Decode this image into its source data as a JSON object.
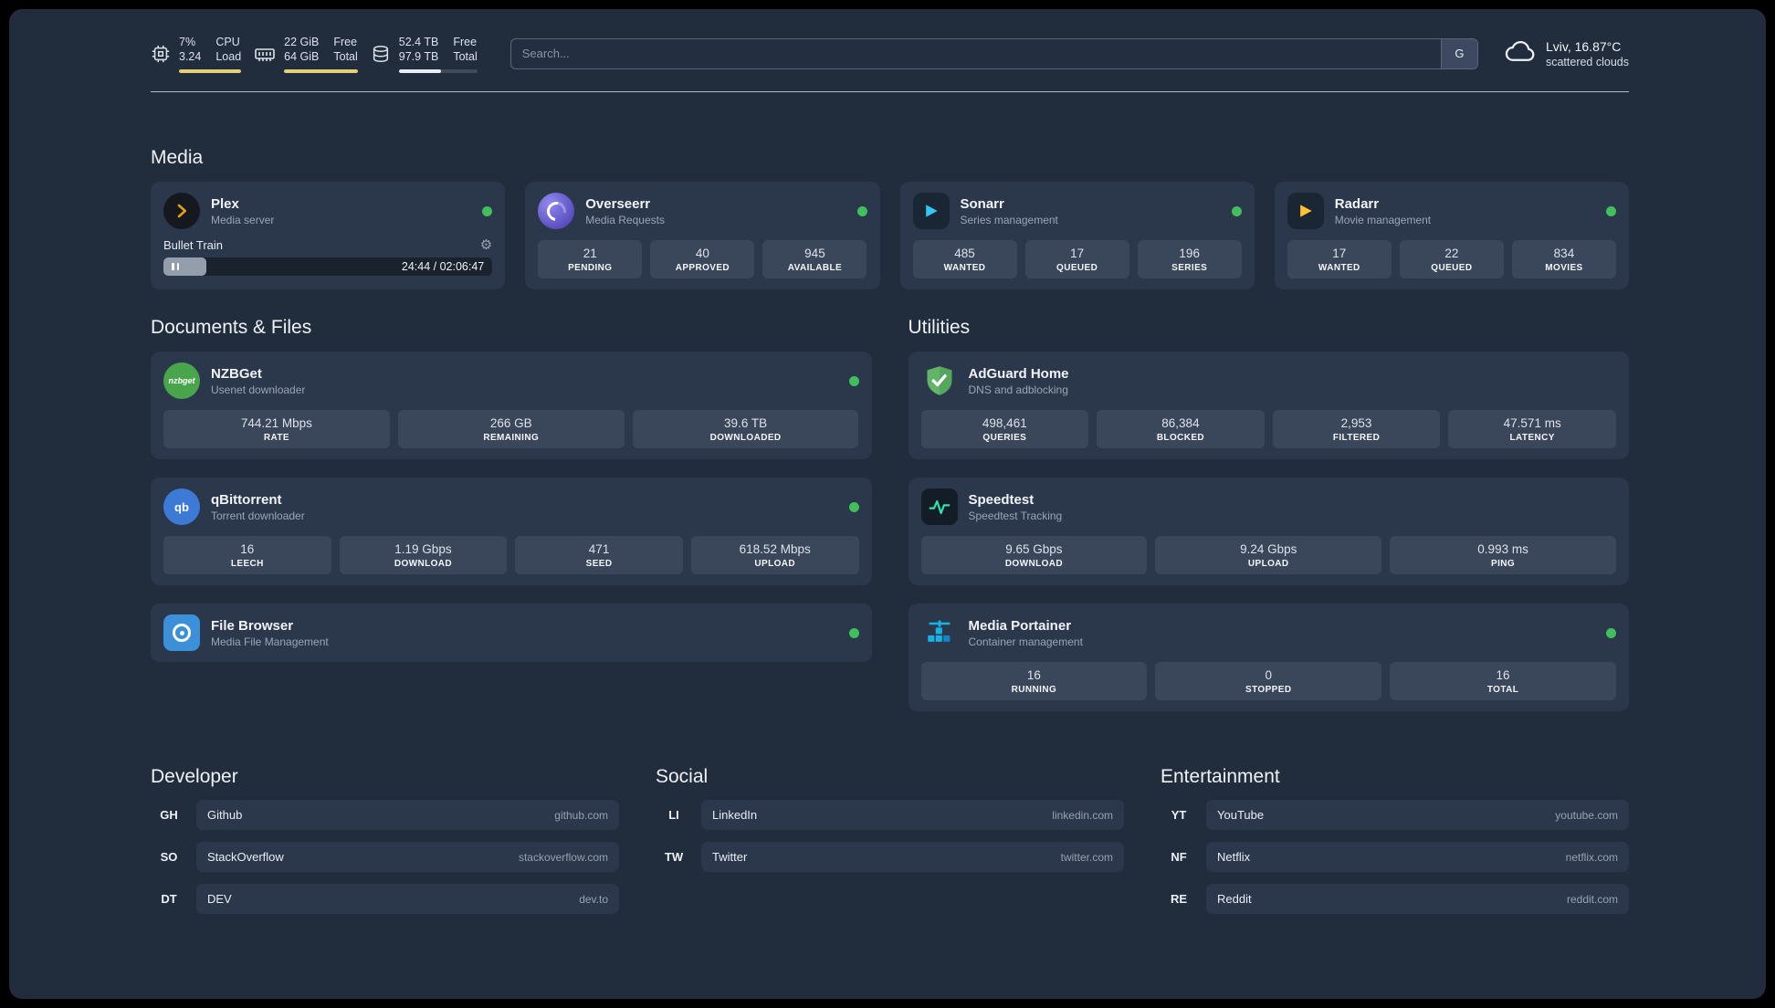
{
  "topbar": {
    "cpu": {
      "value_top": "7%",
      "value_bottom": "3.24",
      "label_top": "CPU",
      "label_bottom": "Load",
      "bar_percent": 100,
      "icon": "cpu-chip-icon"
    },
    "ram": {
      "value_top": "22 GiB",
      "value_bottom": "64 GiB",
      "label_top": "Free",
      "label_bottom": "Total",
      "bar_percent": 100,
      "icon": "memory-icon"
    },
    "disk": {
      "value_top": "52.4 TB",
      "value_bottom": "97.9 TB",
      "label_top": "Free",
      "label_bottom": "Total",
      "bar_percent": 54,
      "icon": "disk-icon"
    },
    "search": {
      "placeholder": "Search...",
      "engine_button": "G"
    },
    "weather": {
      "location": "Lviv, 16.87°C",
      "condition": "scattered clouds",
      "icon": "cloud-icon"
    }
  },
  "sections": {
    "media": {
      "title": "Media",
      "cards": [
        {
          "name": "Plex",
          "subtitle": "Media server",
          "status": "online",
          "icon": "plex-icon",
          "player": {
            "track": "Bullet Train",
            "time": "24:44 / 02:06:47",
            "progress_percent": 13
          }
        },
        {
          "name": "Overseerr",
          "subtitle": "Media Requests",
          "status": "online",
          "icon": "overseerr-icon",
          "stats": [
            {
              "value": "21",
              "label": "PENDING"
            },
            {
              "value": "40",
              "label": "APPROVED"
            },
            {
              "value": "945",
              "label": "AVAILABLE"
            }
          ]
        },
        {
          "name": "Sonarr",
          "subtitle": "Series management",
          "status": "online",
          "icon": "sonarr-icon",
          "stats": [
            {
              "value": "485",
              "label": "WANTED"
            },
            {
              "value": "17",
              "label": "QUEUED"
            },
            {
              "value": "196",
              "label": "SERIES"
            }
          ]
        },
        {
          "name": "Radarr",
          "subtitle": "Movie management",
          "status": "online",
          "icon": "radarr-icon",
          "stats": [
            {
              "value": "17",
              "label": "WANTED"
            },
            {
              "value": "22",
              "label": "QUEUED"
            },
            {
              "value": "834",
              "label": "MOVIES"
            }
          ]
        }
      ]
    },
    "documents": {
      "title": "Documents & Files",
      "cards": [
        {
          "name": "NZBGet",
          "subtitle": "Usenet downloader",
          "status": "online",
          "icon": "nzbget-icon",
          "stats": [
            {
              "value": "744.21 Mbps",
              "label": "RATE"
            },
            {
              "value": "266 GB",
              "label": "REMAINING"
            },
            {
              "value": "39.6 TB",
              "label": "DOWNLOADED"
            }
          ]
        },
        {
          "name": "qBittorrent",
          "subtitle": "Torrent downloader",
          "status": "online",
          "icon": "qbittorrent-icon",
          "stats": [
            {
              "value": "16",
              "label": "LEECH"
            },
            {
              "value": "1.19 Gbps",
              "label": "DOWNLOAD"
            },
            {
              "value": "471",
              "label": "SEED"
            },
            {
              "value": "618.52 Mbps",
              "label": "UPLOAD"
            }
          ]
        },
        {
          "name": "File Browser",
          "subtitle": "Media File Management",
          "status": "online",
          "icon": "filebrowser-icon"
        }
      ]
    },
    "utilities": {
      "title": "Utilities",
      "cards": [
        {
          "name": "AdGuard Home",
          "subtitle": "DNS and adblocking",
          "icon": "adguard-shield-icon",
          "stats": [
            {
              "value": "498,461",
              "label": "QUERIES"
            },
            {
              "value": "86,384",
              "label": "BLOCKED"
            },
            {
              "value": "2,953",
              "label": "FILTERED"
            },
            {
              "value": "47.571 ms",
              "label": "LATENCY"
            }
          ]
        },
        {
          "name": "Speedtest",
          "subtitle": "Speedtest Tracking",
          "icon": "speedtest-graph-icon",
          "stats": [
            {
              "value": "9.65 Gbps",
              "label": "DOWNLOAD"
            },
            {
              "value": "9.24 Gbps",
              "label": "UPLOAD"
            },
            {
              "value": "0.993 ms",
              "label": "PING"
            }
          ]
        },
        {
          "name": "Media Portainer",
          "subtitle": "Container management",
          "status": "online",
          "icon": "portainer-icon",
          "stats": [
            {
              "value": "16",
              "label": "RUNNING"
            },
            {
              "value": "0",
              "label": "STOPPED"
            },
            {
              "value": "16",
              "label": "TOTAL"
            }
          ]
        }
      ]
    },
    "links": [
      {
        "title": "Developer",
        "items": [
          {
            "badge": "GH",
            "name": "Github",
            "domain": "github.com"
          },
          {
            "badge": "SO",
            "name": "StackOverflow",
            "domain": "stackoverflow.com"
          },
          {
            "badge": "DT",
            "name": "DEV",
            "domain": "dev.to"
          }
        ]
      },
      {
        "title": "Social",
        "items": [
          {
            "badge": "LI",
            "name": "LinkedIn",
            "domain": "linkedin.com"
          },
          {
            "badge": "TW",
            "name": "Twitter",
            "domain": "twitter.com"
          }
        ]
      },
      {
        "title": "Entertainment",
        "items": [
          {
            "badge": "YT",
            "name": "YouTube",
            "domain": "youtube.com"
          },
          {
            "badge": "NF",
            "name": "Netflix",
            "domain": "netflix.com"
          },
          {
            "badge": "RE",
            "name": "Reddit",
            "domain": "reddit.com"
          }
        ]
      }
    ]
  },
  "colors": {
    "background": "#212c3d",
    "card": "#2b374a",
    "stat_tile": "#3a4659",
    "status_online": "#41bf5c",
    "usage_bar_yellow": "#e4d077",
    "usage_bar_white": "#e9edf4",
    "plex_gold": "#e5a00d",
    "overseerr_purple": "#6a5fd6",
    "sonarr_blue": "#35c5f4",
    "radarr_yellow": "#ffc230",
    "nzbget_green": "#48a54c",
    "qbittorrent_blue": "#3d7ad6",
    "filebrowser_blue": "#3c8fd9",
    "adguard_green": "#62b466",
    "speedtest_green": "#2ee6a8",
    "portainer_blue": "#19b1e7"
  }
}
